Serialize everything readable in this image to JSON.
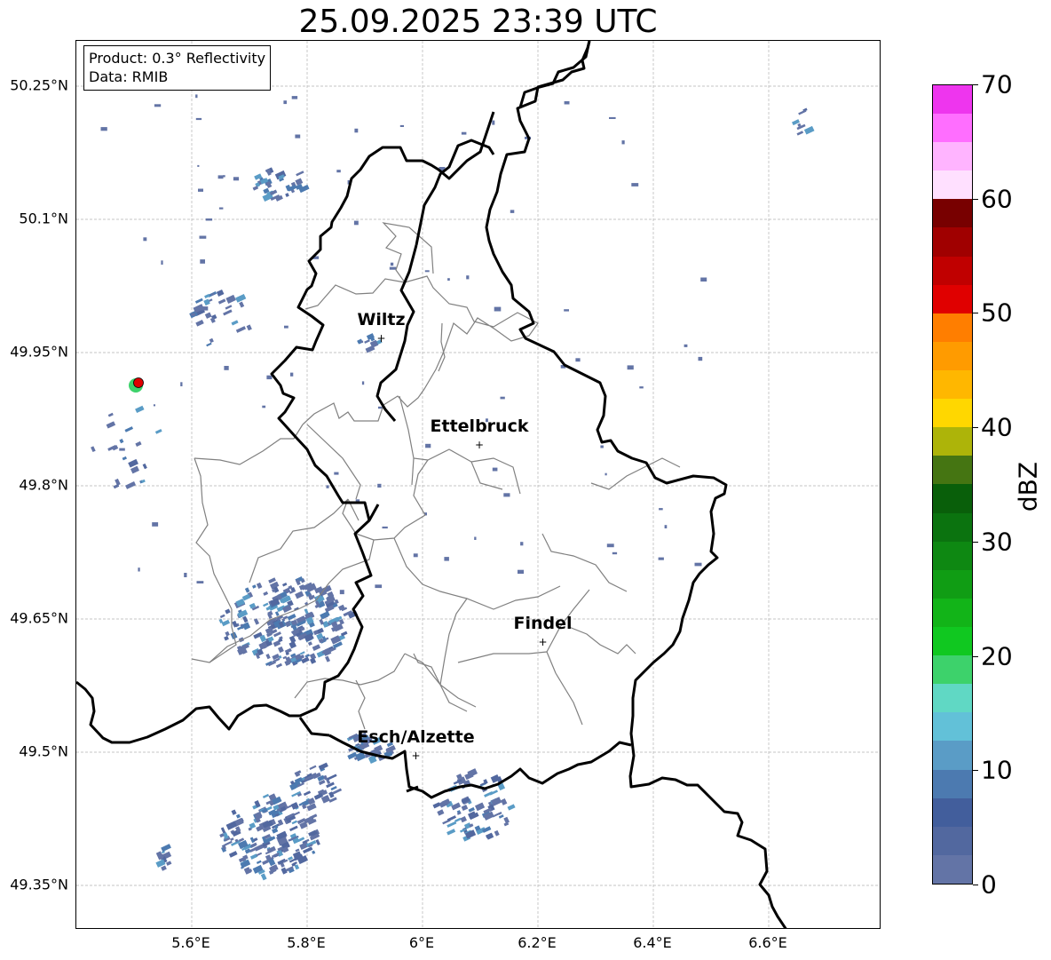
{
  "title": "25.09.2025 23:39 UTC",
  "info": {
    "product": "Product: 0.3° Reflectivity",
    "source": "Data: RMIB"
  },
  "map": {
    "lon_range": [
      5.4,
      6.8
    ],
    "lat_range": [
      49.3,
      50.3
    ],
    "gridlines": true,
    "border_color": "#000000",
    "district_color": "#808080",
    "radar_site_color": "#e00000"
  },
  "lat_labels": [
    "50.25°N",
    "50.1°N",
    "49.95°N",
    "49.8°N",
    "49.65°N",
    "49.5°N",
    "49.35°N"
  ],
  "lon_labels": [
    "5.6°E",
    "5.8°E",
    "6°E",
    "6.2°E",
    "6.4°E",
    "6.6°E"
  ],
  "cities": [
    {
      "name": "Wiltz",
      "lon": 5.93,
      "lat": 49.965
    },
    {
      "name": "Ettelbruck",
      "lon": 6.1,
      "lat": 49.845
    },
    {
      "name": "Findel",
      "lon": 6.21,
      "lat": 49.623
    },
    {
      "name": "Esch/Alzette",
      "lon": 5.99,
      "lat": 49.495
    }
  ],
  "colorbar": {
    "label": "dBZ",
    "ticks": [
      "0",
      "10",
      "20",
      "30",
      "40",
      "50",
      "60",
      "70"
    ],
    "colors": [
      "#6374a6",
      "#52689f",
      "#425e9c",
      "#4c7ab0",
      "#5a9cc6",
      "#62c1d8",
      "#60d8c4",
      "#3dd26b",
      "#10c820",
      "#12b418",
      "#109d14",
      "#0e8812",
      "#0b730f",
      "#095f0a",
      "#457512",
      "#adb409",
      "#ffd700",
      "#ffb700",
      "#ff9b00",
      "#ff7e00",
      "#e00000",
      "#c00000",
      "#a00000",
      "#780000",
      "#ffe0ff",
      "#ffb4ff",
      "#ff6eff",
      "#ee35ee"
    ]
  }
}
